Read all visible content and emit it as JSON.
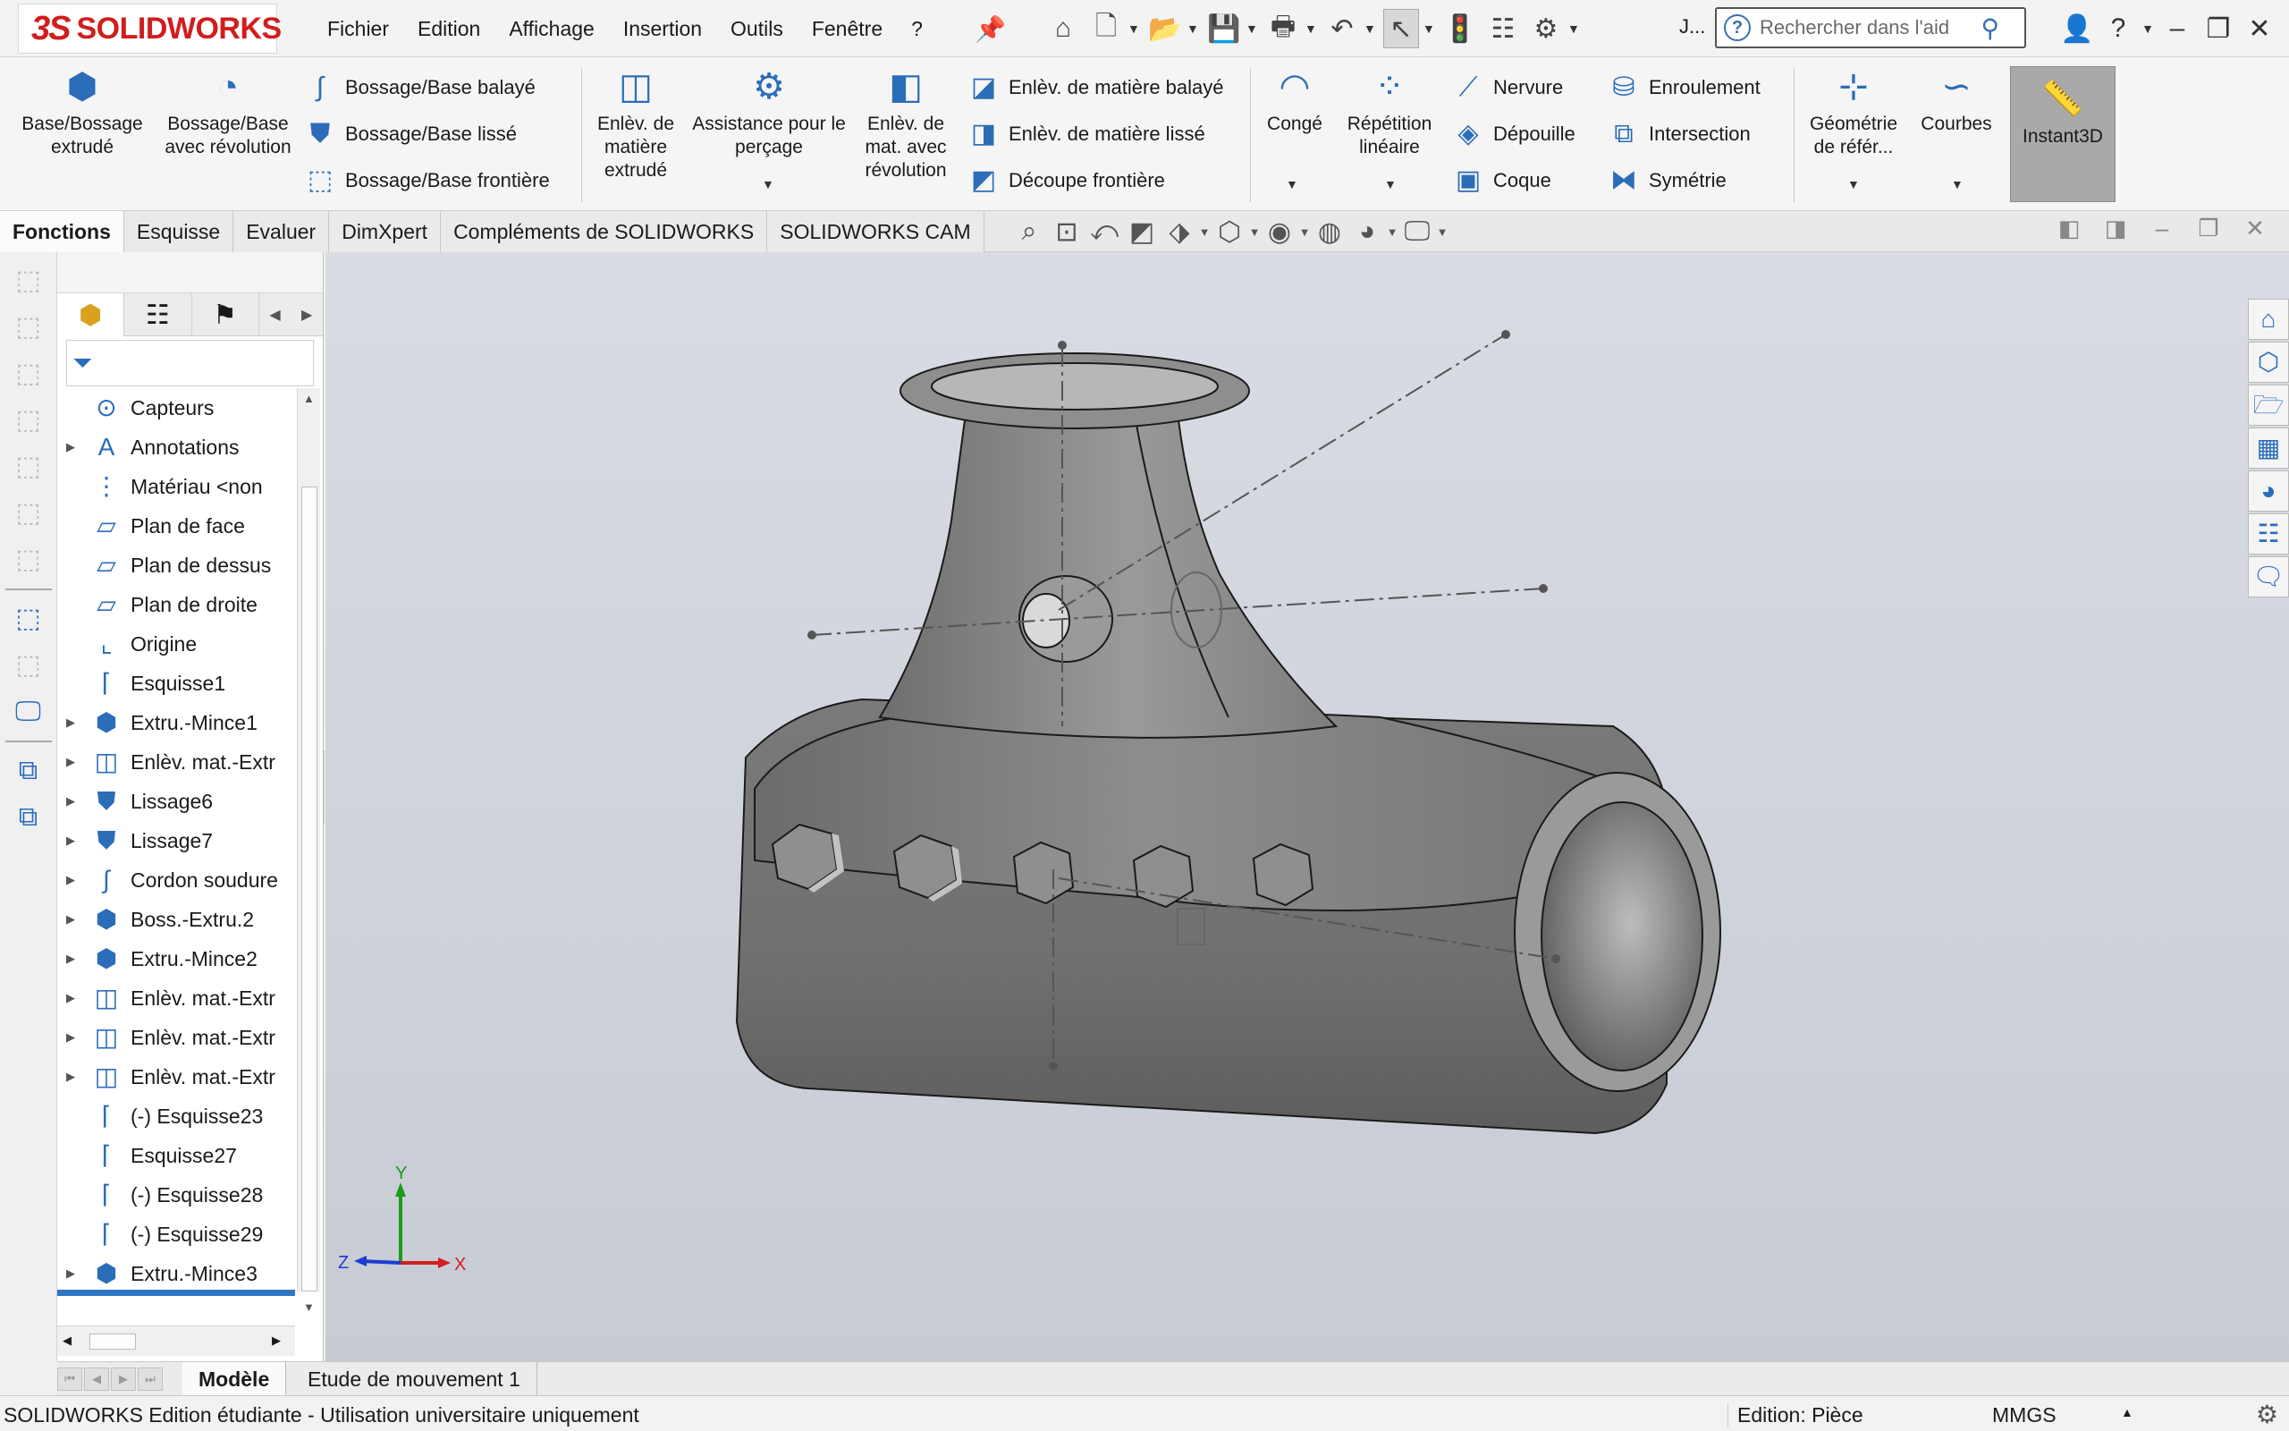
{
  "app": {
    "logo_ds": "3S",
    "logo_name": "SOLIDWORKS",
    "menus": [
      "Fichier",
      "Edition",
      "Affichage",
      "Insertion",
      "Outils",
      "Fenêtre",
      "?"
    ],
    "user_initial": "J...",
    "search_placeholder": "Rechercher dans l'aid"
  },
  "commands": {
    "extrude": "Base/Bossage extrudé",
    "revolve": "Bossage/Base avec révolution",
    "sweep": "Bossage/Base balayé",
    "loft": "Bossage/Base lissé",
    "boundary": "Bossage/Base frontière",
    "cut_extrude": "Enlèv. de matière extrudé",
    "hole_wizard": "Assistance pour le perçage",
    "cut_revolve": "Enlèv. de mat. avec révolution",
    "cut_sweep": "Enlèv. de matière balayé",
    "cut_loft": "Enlèv. de matière lissé",
    "cut_boundary": "Découpe frontière",
    "fillet": "Congé",
    "pattern": "Répétition linéaire",
    "rib": "Nervure",
    "draft": "Dépouille",
    "shell": "Coque",
    "wrap": "Enroulement",
    "intersect": "Intersection",
    "mirror": "Symétrie",
    "ref_geometry": "Géométrie de référ...",
    "curves": "Courbes",
    "instant3d": "Instant3D"
  },
  "tabs": [
    "Fonctions",
    "Esquisse",
    "Evaluer",
    "DimXpert",
    "Compléments de SOLIDWORKS",
    "SOLIDWORKS CAM"
  ],
  "active_tab": "Fonctions",
  "tree": [
    {
      "label": "Capteurs",
      "icon": "sensor-icon",
      "expandable": false
    },
    {
      "label": "Annotations",
      "icon": "annotation-icon",
      "expandable": true
    },
    {
      "label": "Matériau <non",
      "icon": "material-icon",
      "expandable": false
    },
    {
      "label": "Plan de face",
      "icon": "plane-icon",
      "expandable": false
    },
    {
      "label": "Plan de dessus",
      "icon": "plane-icon",
      "expandable": false
    },
    {
      "label": "Plan de droite",
      "icon": "plane-icon",
      "expandable": false
    },
    {
      "label": "Origine",
      "icon": "origin-icon",
      "expandable": false
    },
    {
      "label": "Esquisse1",
      "icon": "sketch-icon",
      "expandable": false
    },
    {
      "label": "Extru.-Mince1",
      "icon": "extrude-icon",
      "expandable": true
    },
    {
      "label": "Enlèv. mat.-Extr",
      "icon": "cut-icon",
      "expandable": true
    },
    {
      "label": "Lissage6",
      "icon": "loft-icon",
      "expandable": true
    },
    {
      "label": "Lissage7",
      "icon": "loft-icon",
      "expandable": true
    },
    {
      "label": "Cordon soudure",
      "icon": "weld-icon",
      "expandable": true
    },
    {
      "label": "Boss.-Extru.2",
      "icon": "extrude-icon",
      "expandable": true
    },
    {
      "label": "Extru.-Mince2",
      "icon": "extrude-icon",
      "expandable": true
    },
    {
      "label": "Enlèv. mat.-Extr",
      "icon": "cut-icon",
      "expandable": true
    },
    {
      "label": "Enlèv. mat.-Extr",
      "icon": "cut-icon",
      "expandable": true
    },
    {
      "label": "Enlèv. mat.-Extr",
      "icon": "cut-icon",
      "expandable": true
    },
    {
      "label": "(-) Esquisse23",
      "icon": "sketch-icon",
      "expandable": false
    },
    {
      "label": "Esquisse27",
      "icon": "sketch-icon",
      "expandable": false
    },
    {
      "label": "(-) Esquisse28",
      "icon": "sketch-icon",
      "expandable": false
    },
    {
      "label": "(-) Esquisse29",
      "icon": "sketch-icon",
      "expandable": false
    },
    {
      "label": "Extru.-Mince3",
      "icon": "extrude-icon",
      "expandable": true
    }
  ],
  "triad": {
    "x": "X",
    "y": "Y",
    "z": "Z"
  },
  "bottom_tabs": [
    "Modèle",
    "Etude de mouvement 1"
  ],
  "status": {
    "left": "SOLIDWORKS Edition étudiante - Utilisation universitaire uniquement",
    "mode": "Edition: Pièce",
    "units": "MMGS"
  },
  "colors": {
    "brand": "#d11d1d",
    "accent": "#2f76c4",
    "viewport_top": "#d9dce3",
    "viewport_bottom": "#c7cbd3"
  }
}
